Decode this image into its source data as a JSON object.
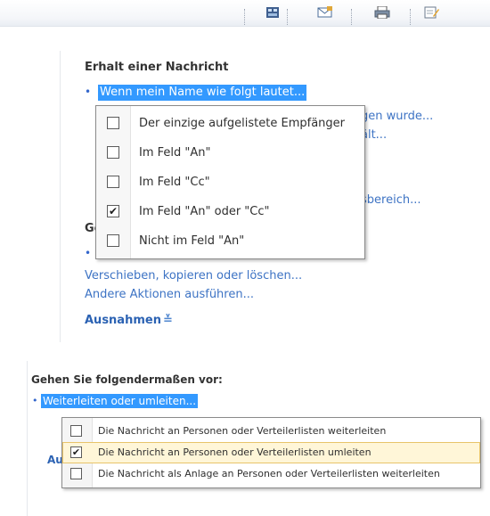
{
  "toolbar": {
    "icons": [
      "grid-icon",
      "envelope-icon",
      "printer-icon",
      "notepad-icon"
    ]
  },
  "panel1": {
    "title": "Erhalt einer Nachricht",
    "selected_link": "Wenn mein Name wie folgt lautet...",
    "background_line1": "gen wurde...",
    "background_line2": "ält...",
    "background_line3": "sbereich...",
    "partial_heading": "Ge",
    "links": [
      "Verschieben, kopieren oder löschen...",
      "Andere Aktionen ausführen..."
    ],
    "exceptions_label": "Ausnahmen",
    "dropdown": [
      {
        "label": "Der einzige aufgelistete Empfänger",
        "checked": false
      },
      {
        "label": "Im Feld \"An\"",
        "checked": false
      },
      {
        "label": "Im Feld \"Cc\"",
        "checked": false
      },
      {
        "label": "Im Feld \"An\" oder \"Cc\"",
        "checked": true
      },
      {
        "label": "Nicht im Feld \"An\"",
        "checked": false
      }
    ]
  },
  "panel2": {
    "title": "Gehen Sie folgendermaßen vor:",
    "selected_link": "Weiterleiten oder umleiten...",
    "partial_heading": "Au",
    "dropdown": [
      {
        "label": "Die Nachricht an Personen oder Verteilerlisten weiterleiten",
        "checked": false
      },
      {
        "label": "Die Nachricht an Personen oder Verteilerlisten umleiten",
        "checked": true
      },
      {
        "label": "Die Nachricht als Anlage an Personen oder Verteilerlisten weiterleiten",
        "checked": false
      }
    ]
  },
  "colors": {
    "selection": "#3399ff",
    "link": "#3d73c4",
    "highlight_row": "#fff6d8"
  }
}
